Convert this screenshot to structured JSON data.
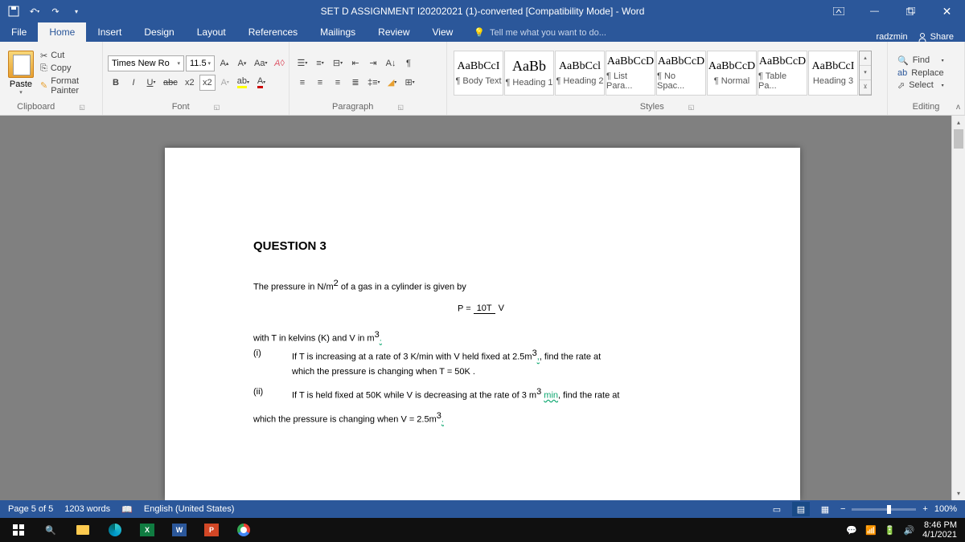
{
  "title": "SET D ASSIGNMENT I20202021 (1)-converted [Compatibility Mode] - Word",
  "user": "radzmin",
  "share": "Share",
  "tabs": [
    "File",
    "Home",
    "Insert",
    "Design",
    "Layout",
    "References",
    "Mailings",
    "Review",
    "View"
  ],
  "tellme": "Tell me what you want to do...",
  "clipboard": {
    "cut": "Cut",
    "copy": "Copy",
    "fp": "Format Painter",
    "paste": "Paste",
    "label": "Clipboard"
  },
  "font": {
    "name": "Times New Ro",
    "size": "11.5",
    "label": "Font"
  },
  "paragraph": {
    "label": "Paragraph"
  },
  "styles": {
    "label": "Styles",
    "items": [
      {
        "prev": "AaBbCcI",
        "name": "¶ Body Text"
      },
      {
        "prev": "AaBb",
        "name": "¶ Heading 1"
      },
      {
        "prev": "AaBbCcl",
        "name": "¶ Heading 2"
      },
      {
        "prev": "AaBbCcD",
        "name": "¶ List Para..."
      },
      {
        "prev": "AaBbCcD",
        "name": "¶ No Spac..."
      },
      {
        "prev": "AaBbCcD",
        "name": "¶ Normal"
      },
      {
        "prev": "AaBbCcD",
        "name": "¶ Table Pa..."
      },
      {
        "prev": "AaBbCcI",
        "name": "Heading 3"
      }
    ]
  },
  "editing": {
    "find": "Find",
    "replace": "Replace",
    "select": "Select",
    "label": "Editing"
  },
  "doc": {
    "heading": "QUESTION 3",
    "p1a": "The pressure in  N/m",
    "p1b": "   of a gas in a cylinder is given by",
    "eq_lhs": "P = ",
    "eq_num": "10T",
    "eq_den": "V",
    "p2a": "with T in kelvins (K) and V in m",
    "p2b": ".",
    "i_mark": "(i)",
    "i_text1": "If T is increasing at a rate of 3 K/min with V held fixed at 2.5m",
    "i_text1b": ", find the rate at",
    "i_text2": "which the pressure is changing when T = 50K .",
    "ii_mark": "(ii)",
    "ii_text1a": "If T is held fixed at 50K while V is decreasing at the rate of   3 m",
    "ii_text1b": " ",
    "ii_min": "min",
    "ii_text1c": ", find the rate at",
    "p3": "which the pressure is changing when V = 2.5m",
    "p3b": "."
  },
  "status": {
    "page": "Page 5 of 5",
    "words": "1203 words",
    "lang": "English (United States)",
    "zoom": "100%"
  },
  "clock": {
    "time": "8:46 PM",
    "date": "4/1/2021"
  }
}
